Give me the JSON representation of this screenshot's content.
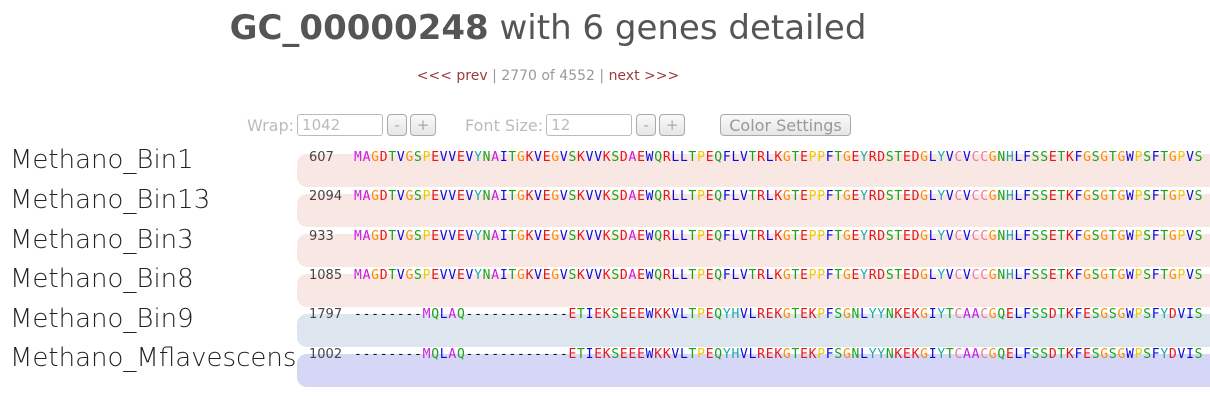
{
  "title": {
    "id": "GC_00000248",
    "rest": " with 6 genes detailed"
  },
  "pager": {
    "prev": "<<< prev",
    "sep1": " | ",
    "status": "2770 of 4552",
    "sep2": " | ",
    "next": "next >>>"
  },
  "controls": {
    "wrap_label": "Wrap:",
    "wrap_value": "1042",
    "font_label": "Font Size:",
    "font_value": "12",
    "minus": "-",
    "plus": "+",
    "color_settings": "Color Settings"
  },
  "genes": [
    {
      "name": "Methano_Bin1",
      "position": "607",
      "sequence": "MAGDTVGSPEVVEVYNAITGKVEGVSKVVKSDAEWQRLLTPEQFLVTRLKGTEPPFTGEYRDSTEDGLYVCVCCGNHLFSSETKFGSGTGWPSFTGPVS",
      "band": "#f9e7e4"
    },
    {
      "name": "Methano_Bin13",
      "position": "2094",
      "sequence": "MAGDTVGSPEVVEVYNAITGKVEGVSKVVKSDAEWQRLLTPEQFLVTRLKGTEPPFTGEYRDSTEDGLYVCVCCGNHLFSSETKFGSGTGWPSFTGPVS",
      "band": "#f9e7e4"
    },
    {
      "name": "Methano_Bin3",
      "position": "933",
      "sequence": "MAGDTVGSPEVVEVYNAITGKVEGVSKVVKSDAEWQRLLTPEQFLVTRLKGTEPPFTGEYRDSTEDGLYVCVCCGNHLFSSETKFGSGTGWPSFTGPVS",
      "band": "#f9e7e4"
    },
    {
      "name": "Methano_Bin8",
      "position": "1085",
      "sequence": "MAGDTVGSPEVVEVYNAITGKVEGVSKVVKSDAEWQRLLTPEQFLVTRLKGTEPPFTGEYRDSTEDGLYVCVCCGNHLFSSETKFGSGTGWPSFTGPVS",
      "band": "#f9e7e4"
    },
    {
      "name": "Methano_Bin9",
      "position": "1797",
      "sequence": "--------MQLAQ------------ETIEKSEEEWKKVLTPEQYHVLREKGTEKPFSGNLYYNKEKGIYTCAACGQELFSSDTKFESGSGWPSFYDVIS",
      "band": "#dde6ee"
    },
    {
      "name": "Methano_Mflavescens",
      "position": "1002",
      "sequence": "--------MQLAQ------------ETIEKSEEEWKKVLTPEQYHVLREKGTEKPFSGNLYYNKEKGIYTCAACGQELFSSDTKFESGSGWPSFYDVIS",
      "band": "#d6d6f6"
    }
  ],
  "residue_colors": {
    "M": "#c81be0",
    "A": "#c81be0",
    "G": "#ff8c00",
    "D": "#e81515",
    "T": "#18a418",
    "V": "#0a0ae0",
    "S": "#18a418",
    "P": "#f0c800",
    "E": "#e81515",
    "Y": "#1aa8a8",
    "N": "#18a418",
    "I": "#0a0ae0",
    "K": "#e81515",
    "W": "#0a0ae0",
    "Q": "#18a418",
    "R": "#e81515",
    "L": "#0a0ae0",
    "F": "#0a0ae0",
    "C": "#f07898",
    "H": "#1aa8a8",
    "-": "#111111"
  }
}
